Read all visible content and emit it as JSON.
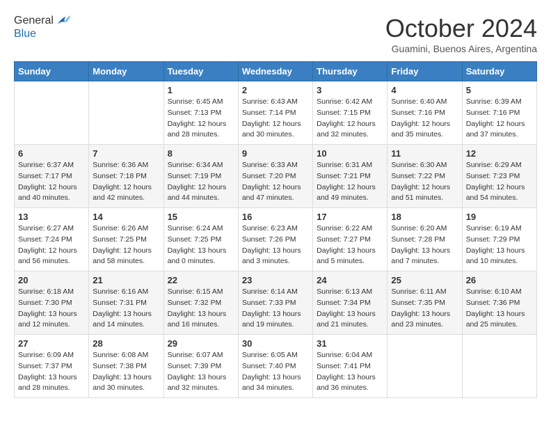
{
  "header": {
    "logo_line1": "General",
    "logo_line2": "Blue",
    "month": "October 2024",
    "location": "Guamini, Buenos Aires, Argentina"
  },
  "weekdays": [
    "Sunday",
    "Monday",
    "Tuesday",
    "Wednesday",
    "Thursday",
    "Friday",
    "Saturday"
  ],
  "weeks": [
    [
      {
        "day": "",
        "info": ""
      },
      {
        "day": "",
        "info": ""
      },
      {
        "day": "1",
        "info": "Sunrise: 6:45 AM\nSunset: 7:13 PM\nDaylight: 12 hours and 28 minutes."
      },
      {
        "day": "2",
        "info": "Sunrise: 6:43 AM\nSunset: 7:14 PM\nDaylight: 12 hours and 30 minutes."
      },
      {
        "day": "3",
        "info": "Sunrise: 6:42 AM\nSunset: 7:15 PM\nDaylight: 12 hours and 32 minutes."
      },
      {
        "day": "4",
        "info": "Sunrise: 6:40 AM\nSunset: 7:16 PM\nDaylight: 12 hours and 35 minutes."
      },
      {
        "day": "5",
        "info": "Sunrise: 6:39 AM\nSunset: 7:16 PM\nDaylight: 12 hours and 37 minutes."
      }
    ],
    [
      {
        "day": "6",
        "info": "Sunrise: 6:37 AM\nSunset: 7:17 PM\nDaylight: 12 hours and 40 minutes."
      },
      {
        "day": "7",
        "info": "Sunrise: 6:36 AM\nSunset: 7:18 PM\nDaylight: 12 hours and 42 minutes."
      },
      {
        "day": "8",
        "info": "Sunrise: 6:34 AM\nSunset: 7:19 PM\nDaylight: 12 hours and 44 minutes."
      },
      {
        "day": "9",
        "info": "Sunrise: 6:33 AM\nSunset: 7:20 PM\nDaylight: 12 hours and 47 minutes."
      },
      {
        "day": "10",
        "info": "Sunrise: 6:31 AM\nSunset: 7:21 PM\nDaylight: 12 hours and 49 minutes."
      },
      {
        "day": "11",
        "info": "Sunrise: 6:30 AM\nSunset: 7:22 PM\nDaylight: 12 hours and 51 minutes."
      },
      {
        "day": "12",
        "info": "Sunrise: 6:29 AM\nSunset: 7:23 PM\nDaylight: 12 hours and 54 minutes."
      }
    ],
    [
      {
        "day": "13",
        "info": "Sunrise: 6:27 AM\nSunset: 7:24 PM\nDaylight: 12 hours and 56 minutes."
      },
      {
        "day": "14",
        "info": "Sunrise: 6:26 AM\nSunset: 7:25 PM\nDaylight: 12 hours and 58 minutes."
      },
      {
        "day": "15",
        "info": "Sunrise: 6:24 AM\nSunset: 7:25 PM\nDaylight: 13 hours and 0 minutes."
      },
      {
        "day": "16",
        "info": "Sunrise: 6:23 AM\nSunset: 7:26 PM\nDaylight: 13 hours and 3 minutes."
      },
      {
        "day": "17",
        "info": "Sunrise: 6:22 AM\nSunset: 7:27 PM\nDaylight: 13 hours and 5 minutes."
      },
      {
        "day": "18",
        "info": "Sunrise: 6:20 AM\nSunset: 7:28 PM\nDaylight: 13 hours and 7 minutes."
      },
      {
        "day": "19",
        "info": "Sunrise: 6:19 AM\nSunset: 7:29 PM\nDaylight: 13 hours and 10 minutes."
      }
    ],
    [
      {
        "day": "20",
        "info": "Sunrise: 6:18 AM\nSunset: 7:30 PM\nDaylight: 13 hours and 12 minutes."
      },
      {
        "day": "21",
        "info": "Sunrise: 6:16 AM\nSunset: 7:31 PM\nDaylight: 13 hours and 14 minutes."
      },
      {
        "day": "22",
        "info": "Sunrise: 6:15 AM\nSunset: 7:32 PM\nDaylight: 13 hours and 16 minutes."
      },
      {
        "day": "23",
        "info": "Sunrise: 6:14 AM\nSunset: 7:33 PM\nDaylight: 13 hours and 19 minutes."
      },
      {
        "day": "24",
        "info": "Sunrise: 6:13 AM\nSunset: 7:34 PM\nDaylight: 13 hours and 21 minutes."
      },
      {
        "day": "25",
        "info": "Sunrise: 6:11 AM\nSunset: 7:35 PM\nDaylight: 13 hours and 23 minutes."
      },
      {
        "day": "26",
        "info": "Sunrise: 6:10 AM\nSunset: 7:36 PM\nDaylight: 13 hours and 25 minutes."
      }
    ],
    [
      {
        "day": "27",
        "info": "Sunrise: 6:09 AM\nSunset: 7:37 PM\nDaylight: 13 hours and 28 minutes."
      },
      {
        "day": "28",
        "info": "Sunrise: 6:08 AM\nSunset: 7:38 PM\nDaylight: 13 hours and 30 minutes."
      },
      {
        "day": "29",
        "info": "Sunrise: 6:07 AM\nSunset: 7:39 PM\nDaylight: 13 hours and 32 minutes."
      },
      {
        "day": "30",
        "info": "Sunrise: 6:05 AM\nSunset: 7:40 PM\nDaylight: 13 hours and 34 minutes."
      },
      {
        "day": "31",
        "info": "Sunrise: 6:04 AM\nSunset: 7:41 PM\nDaylight: 13 hours and 36 minutes."
      },
      {
        "day": "",
        "info": ""
      },
      {
        "day": "",
        "info": ""
      }
    ]
  ]
}
